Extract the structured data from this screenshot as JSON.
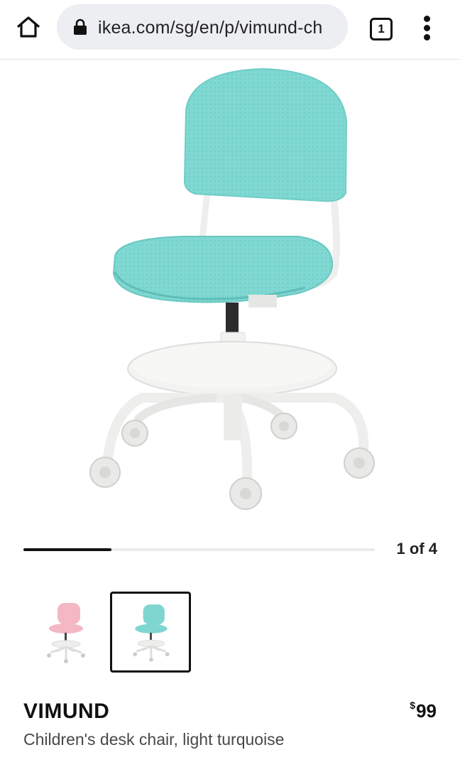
{
  "browser": {
    "url": "ikea.com/sg/en/p/vimund-ch",
    "tab_count": "1",
    "icons": {
      "home": "home-icon",
      "lock": "lock-icon",
      "tabs": "tab-switcher-icon",
      "menu": "more-vert-icon"
    }
  },
  "gallery": {
    "counter": "1 of 4",
    "progress": 0.25,
    "thumbnails": [
      {
        "color": "pink",
        "selected": false
      },
      {
        "color": "light turquoise",
        "selected": true
      }
    ]
  },
  "product": {
    "name": "VIMUND",
    "description": "Children's desk chair, light turquoise",
    "currency": "$",
    "price": "99"
  },
  "colors": {
    "turquoise": "#7fd6d0",
    "pink": "#f4b7c3",
    "chair_frame": "#f1f1ef",
    "text": "#111111"
  }
}
